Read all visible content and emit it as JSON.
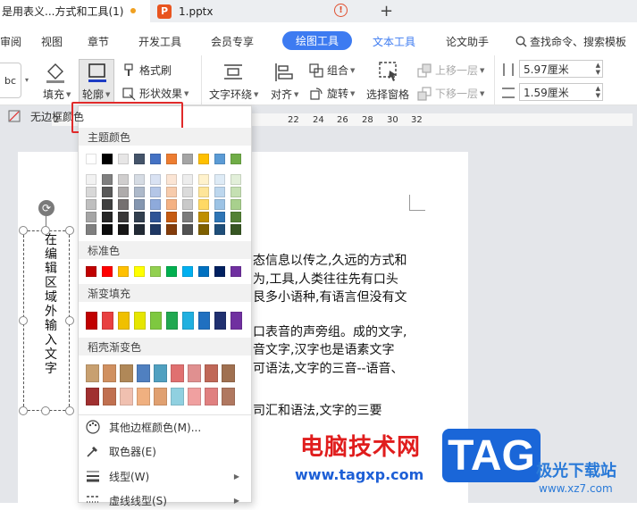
{
  "tabs": [
    {
      "label": "是用表义...方式和工具(1)"
    },
    {
      "label": "1.pptx"
    }
  ],
  "new_tab": "+",
  "menu": {
    "items": [
      "审阅",
      "视图",
      "章节",
      "开发工具",
      "会员专享",
      "绘图工具",
      "文本工具",
      "论文助手"
    ],
    "search": "查找命令、搜索模板"
  },
  "toolbar": {
    "fill": "填充",
    "outline": "轮廓",
    "format_brush": "格式刷",
    "shape_effect": "形状效果",
    "text_wrap": "文字环绕",
    "align": "对齐",
    "group": "组合",
    "rotate": "旋转",
    "select_pane": "选择窗格",
    "bring_forward": "上移一层",
    "send_backward": "下移一层",
    "width": "5.97厘米",
    "height": "1.59厘米",
    "style_label": "bc"
  },
  "ruler": {
    "numbers": [
      "2",
      "22",
      "24",
      "26",
      "28",
      "30",
      "32"
    ]
  },
  "document": {
    "vertical_text": "在编辑区域外输入文字",
    "lines": [
      "态信息以传之,久远的方式和",
      "为,工具,人类往往先有口头",
      "艮多小语种,有语言但没有文",
      "口表音的声旁组。成的文字,",
      "音文字,汉字也是语素文字",
      "可语法,文字的三音--语音、",
      "司汇和语法,文字的三要"
    ]
  },
  "dropdown": {
    "no_border_color": "无边框颜色",
    "theme_colors": "主题颜色",
    "standard_colors": "标准色",
    "gradient_fill": "渐变填充",
    "shell_gradient": "稻壳渐变色",
    "other_colors": "其他边框颜色(M)...",
    "eyedropper": "取色器(E)",
    "line_type": "线型(W)",
    "dash_type": "虚线线型(S)"
  },
  "colors": {
    "accent": "#3d7bf1",
    "highlight": "#e02a2a",
    "theme_top": [
      "#ffffff",
      "#000000",
      "#e7e6e6",
      "#44546a",
      "#4472c4",
      "#ed7d31",
      "#a5a5a5",
      "#ffc000",
      "#5b9bd5",
      "#70ad47"
    ],
    "theme_shades": [
      [
        "#f2f2f2",
        "#7f7f7f",
        "#d0cece",
        "#d6dce4",
        "#d9e2f3",
        "#fbe5d5",
        "#ededed",
        "#fff2cc",
        "#deebf6",
        "#e2efd9"
      ],
      [
        "#d8d8d8",
        "#595959",
        "#aeabab",
        "#adb9ca",
        "#b4c6e7",
        "#f7cbac",
        "#dbdbdb",
        "#fee599",
        "#bdd7ee",
        "#c5e0b3"
      ],
      [
        "#bfbfbf",
        "#3f3f3f",
        "#757070",
        "#8496b0",
        "#8eaadb",
        "#f4b183",
        "#c9c9c9",
        "#ffd965",
        "#9cc3e5",
        "#a8d08d"
      ],
      [
        "#a5a5a5",
        "#262626",
        "#3a3838",
        "#323f4f",
        "#2f5496",
        "#c55a11",
        "#7b7b7b",
        "#bf8f00",
        "#2e75b5",
        "#538135"
      ],
      [
        "#7f7f7f",
        "#0c0c0c",
        "#171616",
        "#222a35",
        "#1f3864",
        "#833c0b",
        "#525252",
        "#7f6000",
        "#1e4e79",
        "#375623"
      ]
    ],
    "standard": [
      "#c00000",
      "#ff0000",
      "#ffc000",
      "#ffff00",
      "#92d050",
      "#00b050",
      "#00b0f0",
      "#0070c0",
      "#002060",
      "#7030a0"
    ],
    "gradient": [
      "#c00000",
      "#e84040",
      "#f0c000",
      "#e6e600",
      "#7ec840",
      "#20a850",
      "#20b0e0",
      "#2070c0",
      "#203070",
      "#7030a0"
    ],
    "shell_row1": [
      "#c8a070",
      "#d09060",
      "#b08858",
      "#5080c0",
      "#50a0c0",
      "#e07070",
      "#e09090",
      "#c06858",
      "#a07050"
    ],
    "shell_row2": [
      "#a03030",
      "#c07050",
      "#f0c0b0",
      "#f0b080",
      "#e0a070",
      "#90d0e0",
      "#f0a0a0",
      "#e08080",
      "#b07860"
    ]
  },
  "watermark": {
    "brand": "电脑技术网",
    "url": "www.tagxp.com",
    "tag": "TAG",
    "site": "极光下载站",
    "site_url": "www.xz7.com"
  }
}
